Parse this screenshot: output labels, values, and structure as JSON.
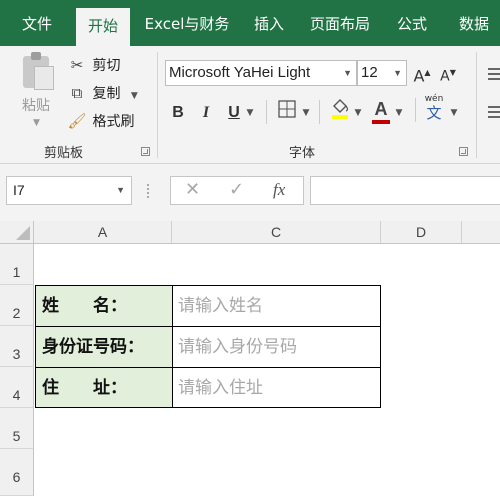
{
  "ribbon_tabs": [
    "文件",
    "开始",
    "Excel与财务",
    "插入",
    "页面布局",
    "公式",
    "数据"
  ],
  "clipboard": {
    "paste_label": "粘贴",
    "cut_label": "剪切",
    "copy_label": "复制",
    "format_painter_label": "格式刷",
    "group_label": "剪贴板"
  },
  "font": {
    "font_name": "Microsoft YaHei Light",
    "font_size": "12",
    "bold": "B",
    "italic": "I",
    "underline": "U",
    "increase_size": "A",
    "decrease_size": "A",
    "font_color_glyph": "A",
    "phonetic_ruby": "wén",
    "phonetic_char": "文",
    "group_label": "字体",
    "font_color": "#c00000",
    "fill_color": "#ffff00"
  },
  "formula_bar": {
    "name_box": "I7",
    "fx": "fx",
    "formula": ""
  },
  "columns": [
    "A",
    "C",
    "D"
  ],
  "rows": [
    "1",
    "2",
    "3",
    "4",
    "5",
    "6"
  ],
  "form": {
    "name_label": "姓　　名：",
    "name_placeholder": "请输入姓名",
    "id_label": "身份证号码：",
    "id_placeholder": "请输入身份号码",
    "address_label": "住　　址：",
    "address_placeholder": "请输入住址"
  },
  "colors": {
    "ribbon_green": "#217346",
    "label_fill": "#e2efda"
  }
}
